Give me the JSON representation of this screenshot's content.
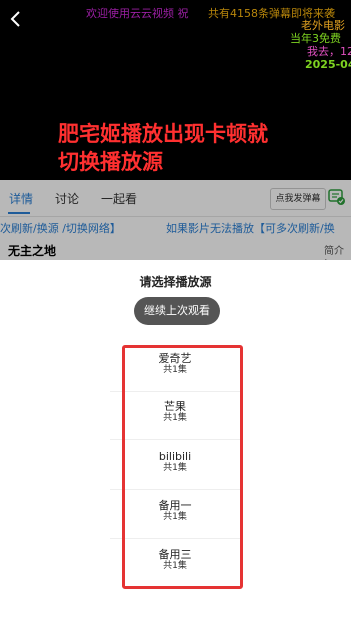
{
  "player": {
    "danmaku": [
      "欢迎使用云云视频 祝",
      "共有4158条弹幕即将来袭",
      "老外电影",
      "当年3免费",
      "我去，12",
      "2025-04"
    ],
    "subtitle_line1": "肥宅姬播放出现卡顿就",
    "subtitle_line2": "切换播放源"
  },
  "tabs": {
    "detail": "详情",
    "discuss": "讨论",
    "watch_together": "一起看",
    "send_danmu": "点我发弹幕"
  },
  "notice": {
    "left": "次刷新/换源 /切换网络】",
    "right": "如果影片无法播放【可多次刷新/换"
  },
  "video": {
    "title": "无主之地",
    "brief_label": "简介 >"
  },
  "sheet": {
    "title": "请选择播放源",
    "continue_label": "继续上次观看",
    "sources": [
      {
        "name": "爱奇艺",
        "count": "共1集"
      },
      {
        "name": "芒果",
        "count": "共1集"
      },
      {
        "name": "bilibili",
        "count": "共1集"
      },
      {
        "name": "备用一",
        "count": "共1集"
      },
      {
        "name": "备用三",
        "count": "共1集"
      }
    ]
  },
  "colors": {
    "accent": "#2a7fd4",
    "highlight": "#e53333",
    "subtitle": "#ff3030"
  }
}
